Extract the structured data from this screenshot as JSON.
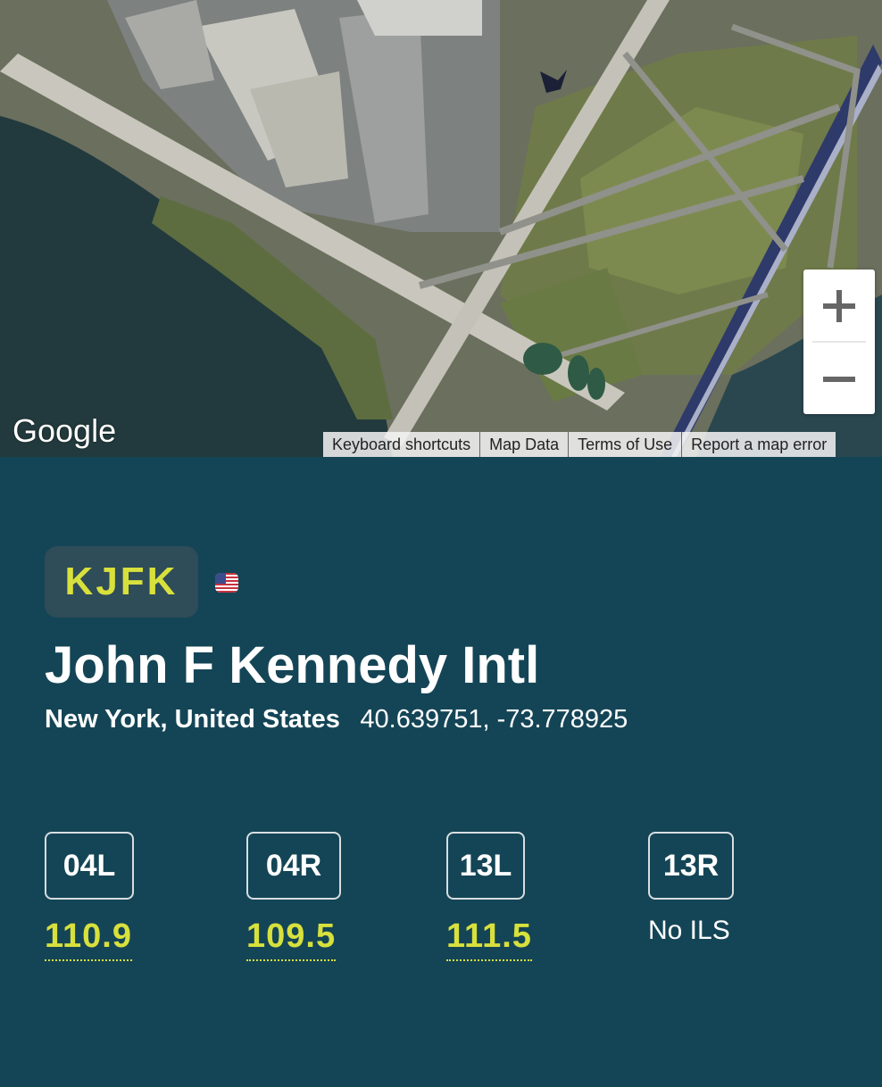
{
  "map": {
    "logo": "Google",
    "footer_links": [
      "Keyboard shortcuts",
      "Map Data",
      "Terms of Use",
      "Report a map error"
    ],
    "zoom_in_icon": "plus-icon",
    "zoom_out_icon": "minus-icon"
  },
  "airport": {
    "icao": "KJFK",
    "flag_icon": "us-flag-icon",
    "name": "John F Kennedy Intl",
    "city": "New York, United States",
    "coordinates": "40.639751, -73.778925"
  },
  "runways": [
    {
      "id": "04L",
      "ils": "110.9"
    },
    {
      "id": "04R",
      "ils": "109.5"
    },
    {
      "id": "13L",
      "ils": "111.5"
    },
    {
      "id": "13R",
      "ils": "No ILS"
    }
  ],
  "colors": {
    "background": "#144556",
    "accent": "#d8e03c",
    "badge": "#2f4c59"
  }
}
